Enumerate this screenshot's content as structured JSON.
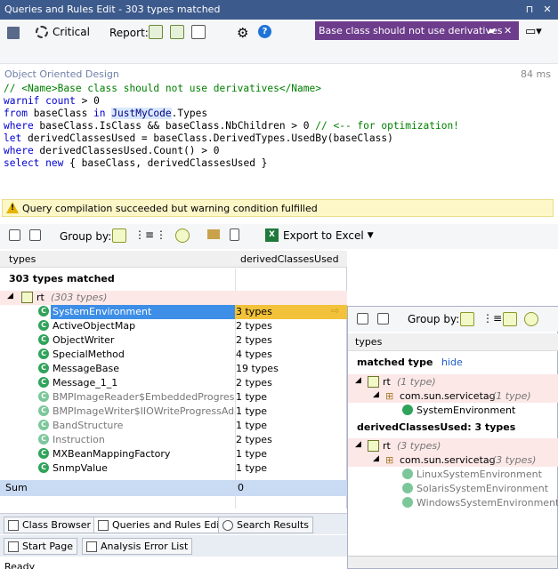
{
  "window": {
    "title": "Queries and Rules Edit  - 303 types matched"
  },
  "toolbar": {
    "critical_label": "Critical",
    "report_label": "Report:"
  },
  "warning_tab": {
    "label": "Base class should not use derivatives"
  },
  "editor": {
    "context": "Object Oriented Design",
    "time": "84 ms",
    "lines": [
      "// <Name>Base class should not use derivatives</Name>",
      "warnif count > 0",
      "from baseClass in JustMyCode.Types",
      "where baseClass.IsClass && baseClass.NbChildren > 0 // <-- for optimization!",
      "let derivedClassesUsed = baseClass.DerivedTypes.UsedBy(baseClass)",
      "where derivedClassesUsed.Count() > 0",
      "select new { baseClass, derivedClassesUsed }"
    ]
  },
  "status": {
    "message": "Query compilation succeeded but warning condition fulfilled"
  },
  "toolbar2": {
    "group_by_label": "Group by:",
    "export_label": "Export to Excel"
  },
  "grid": {
    "columns": [
      "types",
      "derivedClassesUsed"
    ],
    "matched_label": "303 types matched",
    "group": {
      "name": "rt",
      "count": "(303 types)"
    },
    "rows": [
      {
        "name": "SystemEnvironment",
        "value": "3 types",
        "selected": true,
        "dim": false
      },
      {
        "name": "ActiveObjectMap",
        "value": "2 types",
        "selected": false,
        "dim": false
      },
      {
        "name": "ObjectWriter",
        "value": "2 types",
        "selected": false,
        "dim": false
      },
      {
        "name": "SpecialMethod",
        "value": "4 types",
        "selected": false,
        "dim": false
      },
      {
        "name": "MessageBase",
        "value": "19 types",
        "selected": false,
        "dim": false
      },
      {
        "name": "Message_1_1",
        "value": "2 types",
        "selected": false,
        "dim": false
      },
      {
        "name": "BMPImageReader$EmbeddedProgressAd",
        "value": "1 type",
        "selected": false,
        "dim": true
      },
      {
        "name": "BMPImageWriter$IIOWriteProgressAdapt",
        "value": "1 type",
        "selected": false,
        "dim": true
      },
      {
        "name": "BandStructure",
        "value": "1 type",
        "selected": false,
        "dim": true
      },
      {
        "name": "Instruction",
        "value": "2 types",
        "selected": false,
        "dim": true
      },
      {
        "name": "MXBeanMappingFactory",
        "value": "1 type",
        "selected": false,
        "dim": false
      },
      {
        "name": "SnmpValue",
        "value": "1 type",
        "selected": false,
        "dim": false
      }
    ],
    "sum_label": "Sum",
    "sum_value": "0"
  },
  "popup": {
    "group_by_label": "Group by:",
    "column": "types",
    "matched_type_label": "matched type",
    "hide_label": "hide",
    "matched_tree": {
      "root": "rt",
      "root_count": "(1 type)",
      "ns": "com.sun.servicetag",
      "ns_count": "(1 type)",
      "items": [
        "SystemEnvironment"
      ]
    },
    "derived_label": "derivedClassesUsed: 3 types",
    "derived_tree": {
      "root": "rt",
      "root_count": "(3 types)",
      "ns": "com.sun.servicetag",
      "ns_count": "(3 types)",
      "items": [
        "LinuxSystemEnvironment",
        "SolarisSystemEnvironment",
        "WindowsSystemEnvironment"
      ]
    }
  },
  "tabs": {
    "row1": [
      "Class Browser",
      "Queries and Rules Edit",
      "Search Results"
    ],
    "row2": [
      "Start Page",
      "Analysis Error List"
    ]
  },
  "statusline": "Ready"
}
